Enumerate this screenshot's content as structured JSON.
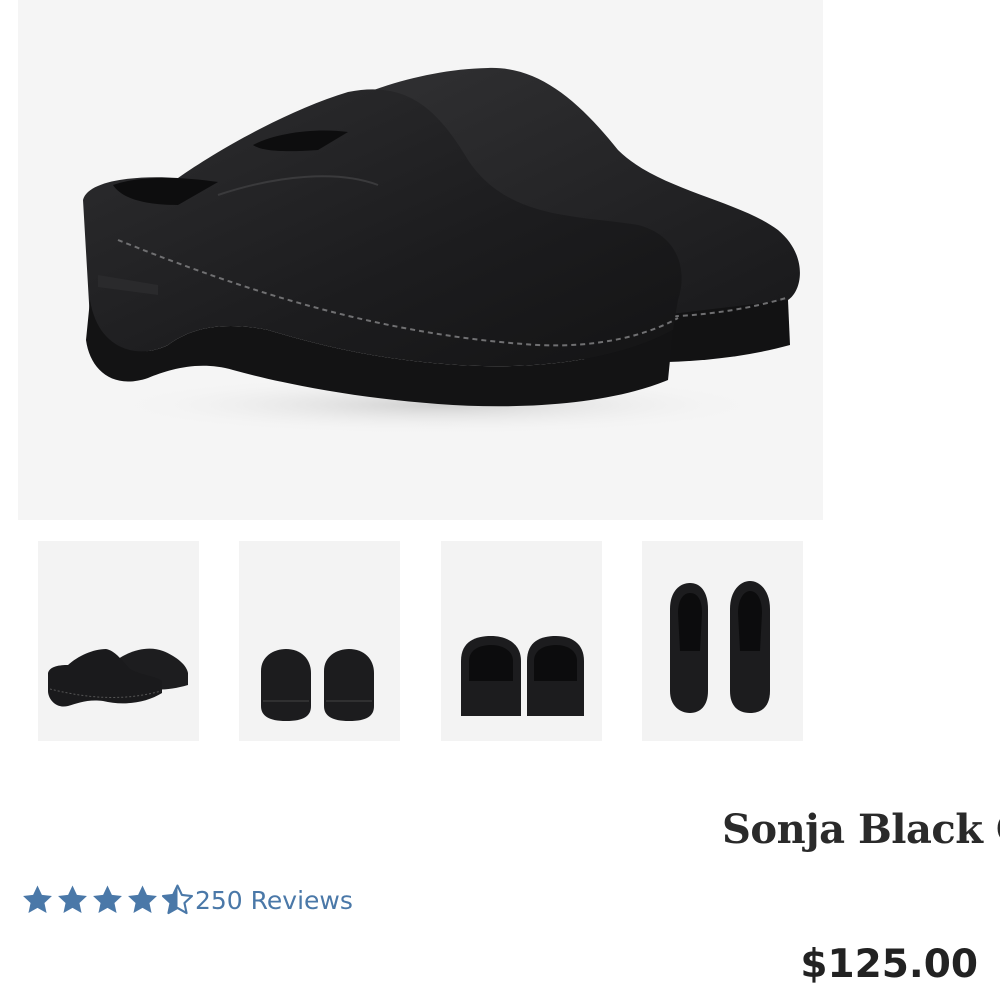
{
  "product": {
    "title": "Sonja Black Oiled",
    "price": "$125.00"
  },
  "rating": {
    "value": 4.5,
    "max": 5,
    "reviews_label": "250 Reviews",
    "star_color": "#4a78a8"
  },
  "gallery": {
    "main_view": "angled pair",
    "thumbnails": [
      {
        "view": "angled pair",
        "selected": true
      },
      {
        "view": "front pair",
        "selected": false
      },
      {
        "view": "back pair",
        "selected": false
      },
      {
        "view": "top pair",
        "selected": false
      }
    ]
  },
  "colors": {
    "image_background": "#f5f5f5",
    "shoe": "#1c1c1e",
    "link": "#4a78a8"
  }
}
